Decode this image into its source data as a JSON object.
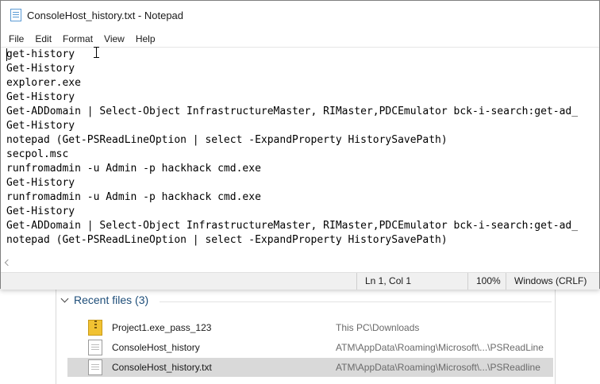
{
  "notepad": {
    "title": "ConsoleHost_history.txt - Notepad",
    "menu": [
      "File",
      "Edit",
      "Format",
      "View",
      "Help"
    ],
    "lines": [
      "get-history",
      "Get-History",
      "explorer.exe",
      "Get-History",
      "Get-ADDomain | Select-Object InfrastructureMaster, RIMaster,PDCEmulator bck-i-search:get-ad_",
      "Get-History",
      "notepad (Get-PSReadLineOption | select -ExpandProperty HistorySavePath)",
      "secpol.msc",
      "runfromadmin -u Admin -p hackhack cmd.exe",
      "Get-History",
      "runfromadmin -u Admin -p hackhack cmd.exe",
      "Get-History",
      "Get-ADDomain | Select-Object InfrastructureMaster, RIMaster,PDCEmulator bck-i-search:get-ad_",
      "notepad (Get-PSReadLineOption | select -ExpandProperty HistorySavePath)"
    ],
    "status": {
      "position": "Ln 1, Col 1",
      "zoom": "100%",
      "line_ending": "Windows (CRLF)"
    }
  },
  "explorer": {
    "recent_header": "Recent files (3)",
    "files": [
      {
        "name": "Project1.exe_pass_123",
        "path": "This PC\\Downloads",
        "icon": "zip-folder-icon",
        "selected": false
      },
      {
        "name": "ConsoleHost_history",
        "path": "ATM\\AppData\\Roaming\\Microsoft\\...\\PSReadLine",
        "icon": "document-icon",
        "selected": false
      },
      {
        "name": "ConsoleHost_history.txt",
        "path": "ATM\\AppData\\Roaming\\Microsoft\\...\\PSReadline",
        "icon": "document-icon",
        "selected": true
      }
    ]
  },
  "colors": {
    "accent_blue": "#1e4e79",
    "selection_gray": "#d9d9d9",
    "statusbar_bg": "#f0f0f0"
  }
}
